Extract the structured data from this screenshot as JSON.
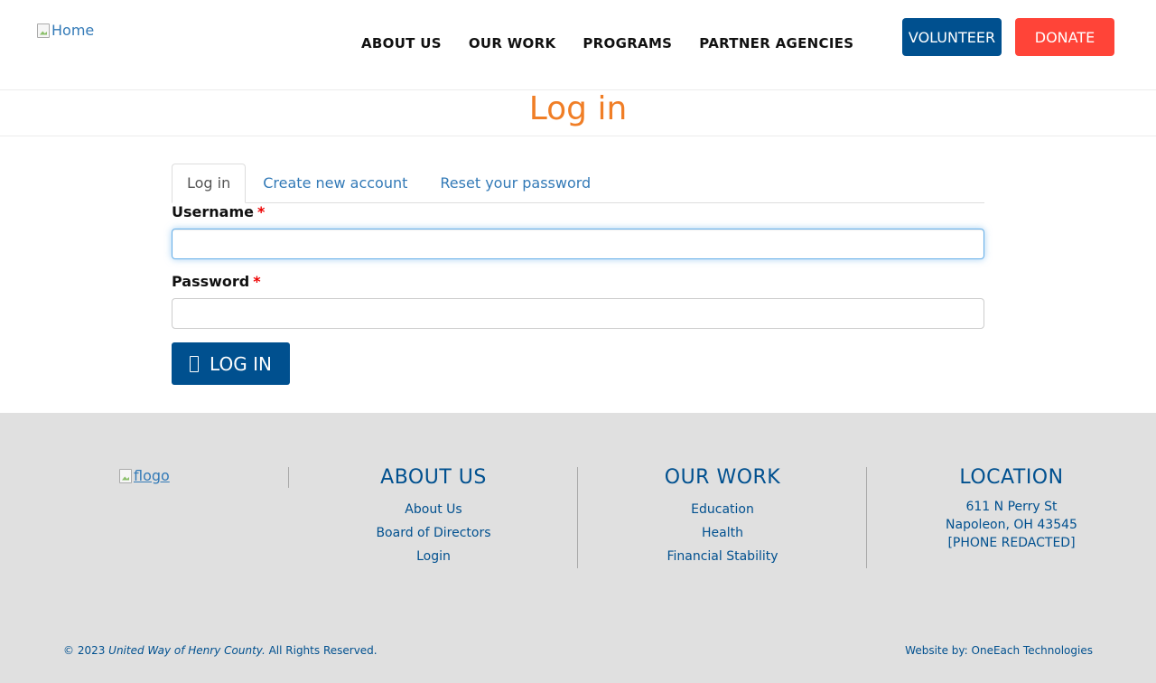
{
  "header": {
    "logo_alt": "Home",
    "nav": [
      "ABOUT US",
      "OUR WORK",
      "PROGRAMS",
      "PARTNER AGENCIES"
    ],
    "volunteer_label": "VOLUNTEER",
    "donate_label": "DONATE"
  },
  "page_title": "Log in",
  "tabs": [
    {
      "label": "Log in",
      "active": true
    },
    {
      "label": "Create new account",
      "active": false
    },
    {
      "label": "Reset your password",
      "active": false
    }
  ],
  "form": {
    "username_label": "Username",
    "username_value": "",
    "password_label": "Password",
    "password_value": "",
    "required_marker": "*",
    "submit_label": "LOG IN"
  },
  "footer": {
    "logo_alt": "flogo",
    "about": {
      "heading": "ABOUT US",
      "links": [
        "About Us",
        "Board of Directors",
        "Login"
      ]
    },
    "work": {
      "heading": "OUR WORK",
      "links": [
        "Education",
        "Health",
        "Financial Stability"
      ]
    },
    "location": {
      "heading": "LOCATION",
      "lines": [
        "611 N Perry St",
        "Napoleon, OH 43545",
        "[PHONE REDACTED]"
      ]
    },
    "copyright_prefix": "© 2023 ",
    "copyright_org": "United Way of Henry County.",
    "copyright_suffix": " All Rights Reserved.",
    "credit_prefix": "Website by: ",
    "credit_link": "OneEach Technologies"
  },
  "colors": {
    "brand_blue": "#00508f",
    "donate_red": "#ff4438",
    "title_orange": "#f07e26",
    "link_blue": "#337ab7",
    "footer_bg": "#e0e0e0"
  }
}
